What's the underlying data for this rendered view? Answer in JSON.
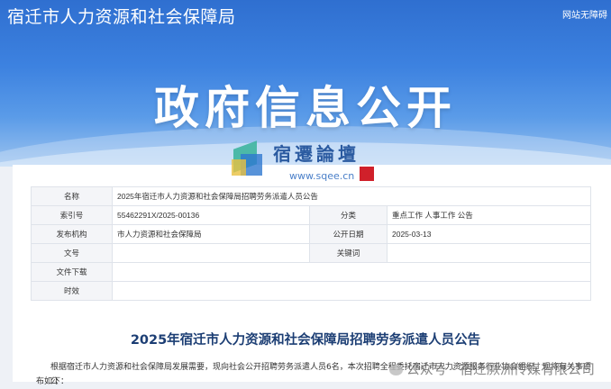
{
  "header": {
    "site_title": "宿迁市人力资源和社会保障局",
    "top_link": "网站无障碍",
    "banner": "政府信息公开"
  },
  "watermark": {
    "brand": "宿遷論壇",
    "url": "www.sqee.cn",
    "seal": "宿遷論壇"
  },
  "meta": {
    "rows": [
      {
        "label": "名称",
        "value": "2025年宿迁市人力资源和社会保障局招聘劳务派遣人员公告"
      },
      {
        "label": "索引号",
        "value": "55462291X/2025-00136",
        "label2": "分类",
        "value2": "重点工作   人事工作   公告"
      },
      {
        "label": "发布机构",
        "value": "市人力资源和社会保障局",
        "label2": "公开日期",
        "value2": "2025-03-13"
      },
      {
        "label": "文号",
        "value": "",
        "label2": "关键词",
        "value2": ""
      },
      {
        "label": "文件下载",
        "value": ""
      },
      {
        "label": "时效",
        "value": ""
      }
    ]
  },
  "article": {
    "title": "2025年宿迁市人力资源和社会保障局招聘劳务派遣人员公告",
    "para1": "根据宿迁市人力资源和社会保障局发展需要，现向社会公开招聘劳务派遣人员6名，本次招聘全程委托宿迁市人力资源服务行业协会组织，现将有关事项公",
    "para2": "布如下："
  },
  "wechat_watermark": "公众号 · 宿迁厥洲传媒有限公司"
}
